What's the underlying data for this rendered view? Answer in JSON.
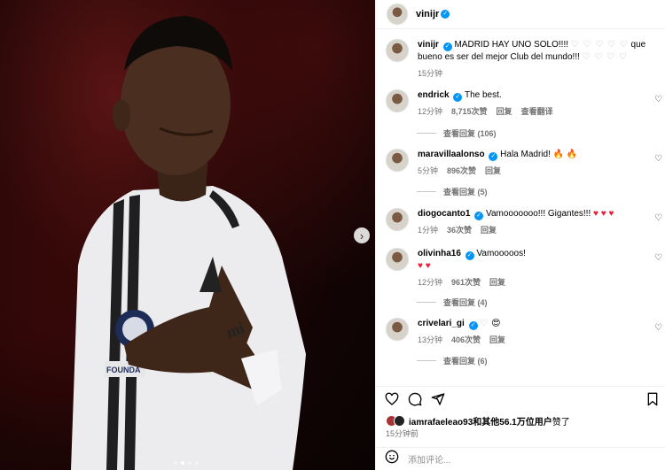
{
  "post": {
    "author": "vinijr",
    "photo_dots": 4,
    "photo_active_dot": 2
  },
  "caption": {
    "user": "vinijr",
    "text_a": "MADRID HAY UNO SOLO!!!!",
    "hearts_a": "♡ ♡ ♡ ♡ ♡",
    "text_b": "que bueno es ser del mejor Club del mundo!!!",
    "hearts_b": "♡ ♡ ♡ ♡",
    "time": "15分钟"
  },
  "comments": [
    {
      "user": "endrick",
      "text": "The best.",
      "emoji": "",
      "time": "12分钟",
      "likes": "8,715次赞",
      "reply": "回复",
      "translate": "查看翻译",
      "replies": "查看回复 (106)"
    },
    {
      "user": "maravillaalonso",
      "text": "Hala Madrid!",
      "emoji": "🔥 🔥",
      "time": "5分钟",
      "likes": "896次赞",
      "reply": "回复",
      "translate": "",
      "replies": "查看回复 (5)"
    },
    {
      "user": "diogocanto1",
      "text": "Vamooooooo!!! Gigantes!!!",
      "emoji": "♥ ♥ ♥",
      "time": "1分钟",
      "likes": "36次赞",
      "reply": "回复",
      "translate": "",
      "replies": ""
    },
    {
      "user": "olivinha16",
      "text": "Vamooooos!",
      "emoji": "♥ ♥",
      "time": "12分钟",
      "likes": "961次赞",
      "reply": "回复",
      "translate": "",
      "replies": "查看回复 (4)"
    },
    {
      "user": "crivelari_gi",
      "text": "♡",
      "emoji": "😍",
      "time": "13分钟",
      "likes": "406次赞",
      "reply": "回复",
      "translate": "",
      "replies": "查看回复 (6)"
    }
  ],
  "likes": {
    "prefix": "iamrafaeleao93和",
    "suffix": "其他56.1万位用户",
    "tail": "赞了"
  },
  "time_ago": "15分钟前",
  "add_comment_placeholder": "添加评论...",
  "colors": {
    "accent": "#0095f6",
    "heart_red": "#ed1c3a",
    "meta_gray": "#737373"
  }
}
